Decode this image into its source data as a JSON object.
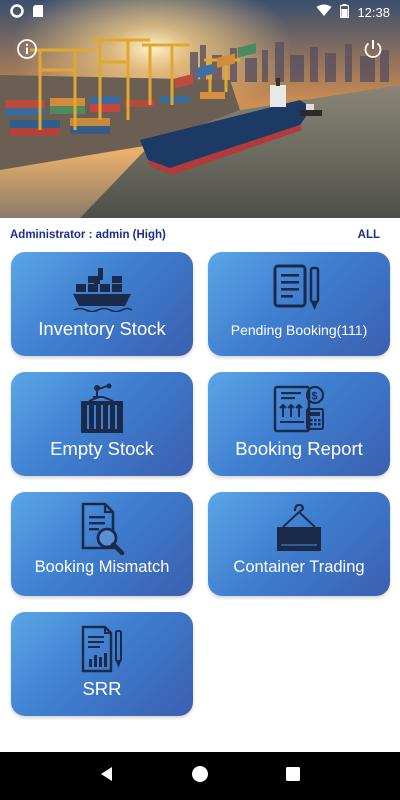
{
  "status_bar": {
    "time": "12:38",
    "icons": [
      "circle-notification-icon",
      "sd-card-icon",
      "wifi-icon",
      "battery-icon"
    ]
  },
  "hero": {
    "image": "container-port-photo",
    "info_icon": "info-icon",
    "power_icon": "power-icon"
  },
  "user": {
    "role_text": "Administrator : admin (High)",
    "filter_text": "ALL"
  },
  "tiles": [
    {
      "label": "Inventory Stock",
      "icon": "cargo-ship-icon"
    },
    {
      "label": "Pending Booking(111)",
      "icon": "document-pen-icon"
    },
    {
      "label": "Empty Stock",
      "icon": "container-crane-icon"
    },
    {
      "label": "Booking Report",
      "icon": "report-chart-icon"
    },
    {
      "label": "Booking Mismatch",
      "icon": "document-search-icon"
    },
    {
      "label": "Container Trading",
      "icon": "hanging-container-icon"
    },
    {
      "label": "SRR",
      "icon": "report-pen-icon"
    }
  ],
  "nav": {
    "back_icon": "back-triangle-icon",
    "home_icon": "home-circle-icon",
    "recents_icon": "recents-square-icon"
  },
  "colors": {
    "accent_text": "#1a2f8f",
    "tile_gradient_start": "#5aa6e6",
    "tile_gradient_end": "#3b5fb0",
    "icon_dark": "#1c2a4a"
  }
}
